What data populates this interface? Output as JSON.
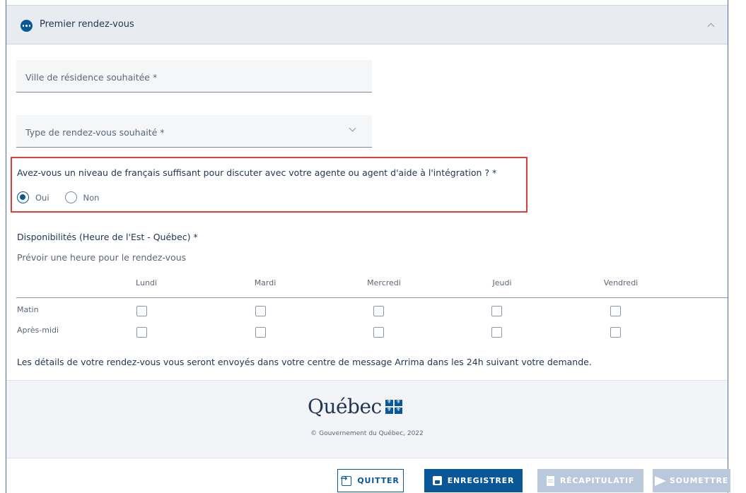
{
  "section": {
    "title": "Premier rendez-vous"
  },
  "fields": {
    "city_label": "Ville de résidence souhaitée *",
    "type_label": "Type de rendez-vous souhaité *"
  },
  "french_question": {
    "text": "Avez-vous un niveau de français suffisant pour discuter avec votre agente ou agent d'aide à l'intégration ? *",
    "options": [
      "Oui",
      "Non"
    ],
    "selected": "Oui"
  },
  "availability": {
    "title": "Disponibilités (Heure de l'Est - Québec) *",
    "subtitle": "Prévoir une heure pour le rendez-vous",
    "days": [
      "Lundi",
      "Mardi",
      "Mercredi",
      "Jeudi",
      "Vendredi"
    ],
    "periods": [
      "Matin",
      "Après-midi"
    ],
    "note": "Les détails de votre rendez-vous vous seront envoyés dans votre centre de message Arrima dans les 24h suivant votre demande."
  },
  "footer": {
    "logo_text": "Québec",
    "copyright": "© Gouvernement du Québec, 2022"
  },
  "actions": {
    "quit": "QUITTER",
    "save": "ENREGISTRER",
    "recap": "RÉCAPITULATIF",
    "submit": "SOUMETTRE"
  },
  "colors": {
    "primary": "#095797",
    "highlight": "#e03e3e",
    "disabled": "#b9c8db"
  }
}
